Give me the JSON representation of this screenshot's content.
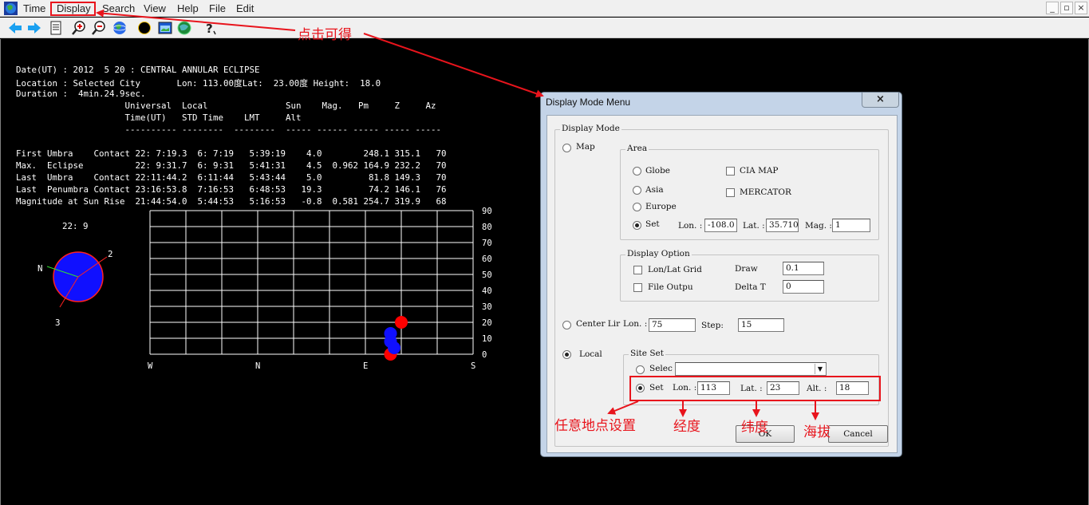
{
  "menubar": {
    "items": [
      "Time",
      "Display",
      "Search",
      "View",
      "Help",
      "File",
      "Edit"
    ],
    "window_controls": [
      "_",
      "▫",
      "×"
    ]
  },
  "toolbar": {
    "buttons": [
      "back-arrow-icon",
      "forward-arrow-icon",
      "document-icon",
      "zoom-in-icon",
      "zoom-out-icon",
      "globe-icon",
      "eclipse-icon",
      "map-window-icon",
      "world-icon",
      "help-icon"
    ]
  },
  "report": {
    "lines": [
      "Date(UT) : 2012  5 20 : CENTRAL ANNULAR ECLIPSE",
      "Location : Selected City       Lon: 113.00度Lat:  23.00度 Height:  18.0",
      "Duration :  4min.24.9sec.",
      "                     Universal  Local               Sun    Mag.   Pm     Z     Az",
      "                     Time(UT)   STD Time    LMT     Alt",
      "                     ---------- --------  --------  ----- ------ ----- ----- -----",
      "",
      "First Umbra    Contact 22: 7:19.3  6: 7:19   5:39:19    4.0        248.1 315.1   70",
      "Max.  Eclipse          22: 9:31.7  6: 9:31   5:41:31    4.5  0.962 164.9 232.2   70",
      "Last  Umbra    Contact 22:11:44.2  6:11:44   5:43:44    5.0         81.8 149.3   70",
      "Last  Penumbra Contact 23:16:53.8  7:16:53   6:48:53   19.3         74.2 146.1   76",
      "Magnitude at Sun Rise  21:44:54.0  5:44:53   5:16:53   -0.8  0.581 254.7 319.9   68"
    ]
  },
  "sun_disk": {
    "time": "22: 9",
    "label_n": "N",
    "label_2": "2",
    "label_3": "3"
  },
  "chart_data": {
    "type": "scatter",
    "x_tick_labels": [
      "W",
      "N",
      "E",
      "S"
    ],
    "y_ticks": [
      0,
      10,
      20,
      30,
      40,
      50,
      60,
      70,
      80,
      90
    ],
    "ylim": [
      0,
      90
    ],
    "x_range_deg": [
      270,
      450
    ],
    "grid": true,
    "series": [
      {
        "color": "#ff0000",
        "points": [
          [
            410,
            20
          ],
          [
            404,
            0
          ]
        ]
      },
      {
        "color": "#1010ff",
        "points": [
          [
            404,
            13
          ],
          [
            404,
            8
          ],
          [
            406,
            4
          ]
        ]
      }
    ]
  },
  "dialog": {
    "title": "Display Mode Menu",
    "close": "×",
    "display_mode_group": "Display Mode",
    "map_radio": "Map",
    "area_group": "Area",
    "globe": "Globe",
    "asia": "Asia",
    "europe": "Europe",
    "set": "Set",
    "cia_map": "CIA MAP",
    "mercator": "MERCATOR",
    "lon_label": "Lon. :",
    "lon_value": "-108.0",
    "lat_label": "Lat. :",
    "lat_value": "35.710",
    "mag_label": "Mag. :",
    "mag_value": "1",
    "display_option_group": "Display Option",
    "lonlat_grid": "Lon/Lat Grid",
    "draw_label": "Draw",
    "draw_value": "0.1",
    "file_output": "File Outpu",
    "delta_t_label": "Delta T",
    "delta_t_value": "0",
    "center_line": "Center Lir",
    "center_lon_label": "Lon. :",
    "center_lon_value": "75",
    "step_label": "Step:",
    "step_value": "15",
    "local_radio": "Local",
    "site_set_group": "Site Set",
    "select_radio": "Selec",
    "select_value": "",
    "site_set_radio": "Set",
    "site_lon_label": "Lon. :",
    "site_lon_value": "113",
    "site_lat_label": "Lat. :",
    "site_lat_value": "23",
    "site_alt_label": "Alt. :",
    "site_alt_value": "18",
    "ok": "OK",
    "cancel": "Cancel"
  },
  "annotations": {
    "click_hint": "点击可得",
    "any_location": "任意地点设置",
    "longitude": "经度",
    "latitude": "纬度",
    "altitude": "海拔",
    "color": "#e8141c"
  }
}
